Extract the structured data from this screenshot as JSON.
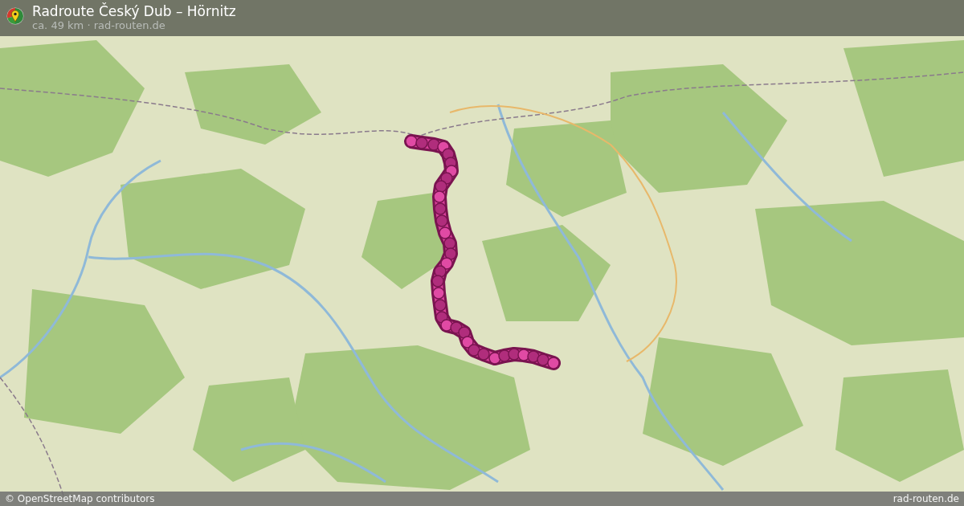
{
  "header": {
    "title": "Radroute Český Dub – Hörnitz",
    "subtitle": "ca. 49 km · rad-routen.de"
  },
  "footer": {
    "attribution": "© OpenStreetMap contributors",
    "site": "rad-routen.de"
  }
}
